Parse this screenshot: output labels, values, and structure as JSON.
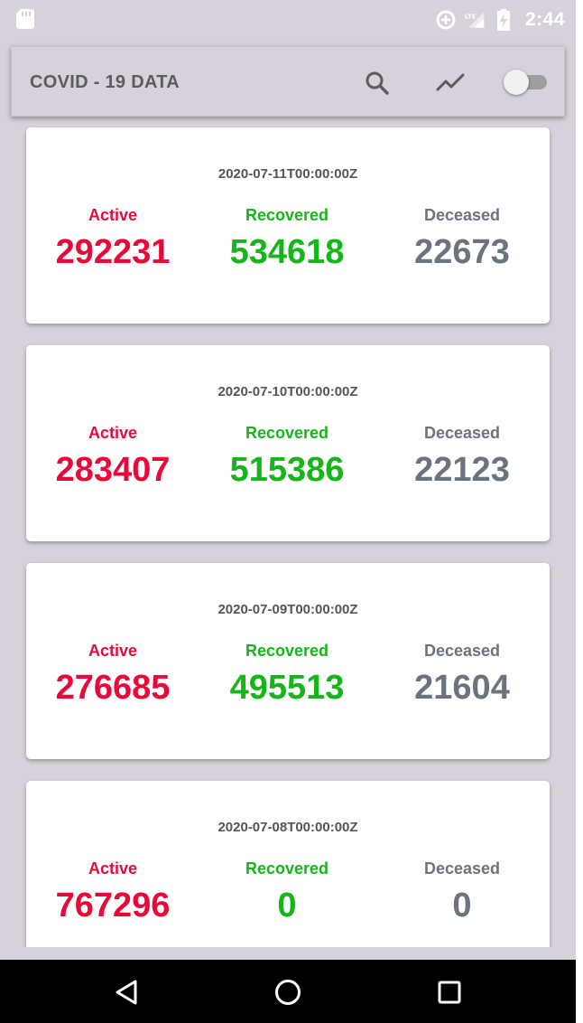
{
  "status_bar": {
    "time": "2:44",
    "icons": [
      "sd-card-icon",
      "data-saver-icon",
      "lte-signal-icon",
      "battery-charging-icon"
    ]
  },
  "app_bar": {
    "title": "COVID - 19 DATA",
    "actions": [
      "search-icon",
      "trending-icon",
      "theme-toggle"
    ],
    "toggle_on": false
  },
  "labels": {
    "active": "Active",
    "recovered": "Recovered",
    "deceased": "Deceased"
  },
  "colors": {
    "active": "#e8093b",
    "recovered": "#16b51a",
    "deceased": "#6b737e",
    "background": "#d6d1da"
  },
  "records": [
    {
      "date": "2020-07-11T00:00:00Z",
      "active": "292231",
      "recovered": "534618",
      "deceased": "22673"
    },
    {
      "date": "2020-07-10T00:00:00Z",
      "active": "283407",
      "recovered": "515386",
      "deceased": "22123"
    },
    {
      "date": "2020-07-09T00:00:00Z",
      "active": "276685",
      "recovered": "495513",
      "deceased": "21604"
    },
    {
      "date": "2020-07-08T00:00:00Z",
      "active": "767296",
      "recovered": "0",
      "deceased": "0"
    }
  ],
  "nav_bar": {
    "buttons": [
      "back-icon",
      "home-icon",
      "recents-icon"
    ]
  }
}
